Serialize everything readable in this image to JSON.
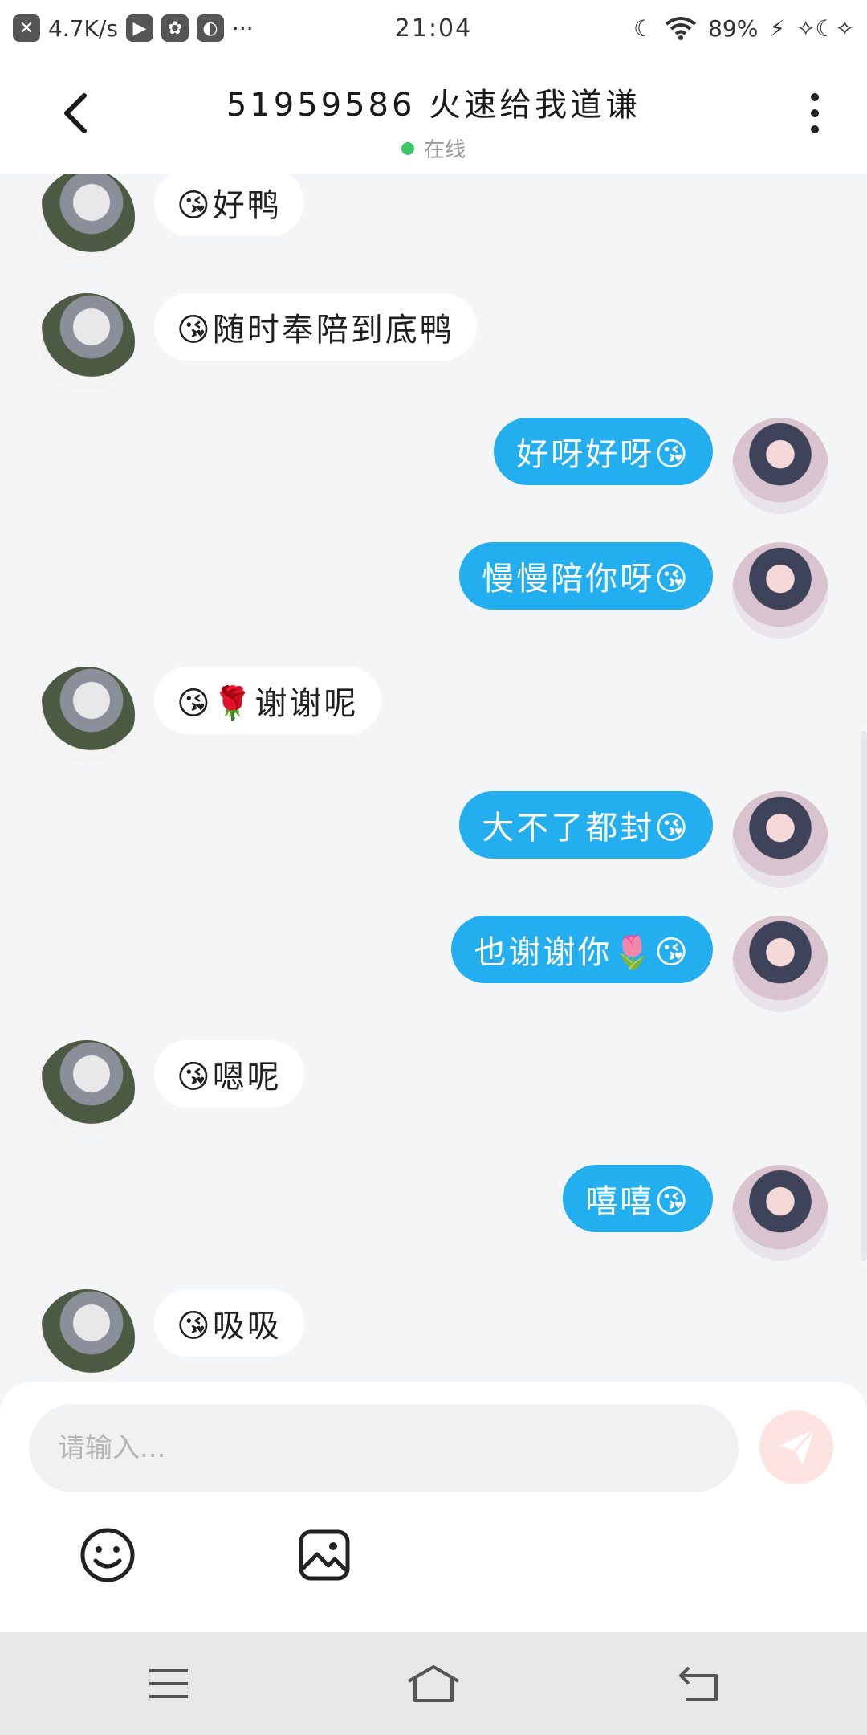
{
  "status_bar": {
    "net_speed": "4.7K/s",
    "time": "21:04",
    "battery": "89%",
    "more": "···"
  },
  "header": {
    "title": "51959586 火速给我道谦",
    "status": "在线"
  },
  "messages": [
    {
      "side": "in",
      "text": "😘好鸭"
    },
    {
      "side": "in",
      "text": "😘随时奉陪到底鸭"
    },
    {
      "side": "out",
      "text": "好呀好呀😘"
    },
    {
      "side": "out",
      "text": "慢慢陪你呀😘"
    },
    {
      "side": "in",
      "text": "😘🌹谢谢呢"
    },
    {
      "side": "out",
      "text": "大不了都封😘"
    },
    {
      "side": "out",
      "text": "也谢谢你🌷😘"
    },
    {
      "side": "in",
      "text": "😘嗯呢"
    },
    {
      "side": "out",
      "text": "嘻嘻😘"
    },
    {
      "side": "in",
      "text": "😘吸吸"
    }
  ],
  "input": {
    "placeholder": "请输入...",
    "value": ""
  },
  "toolbar": {
    "emoji_icon": "smile-icon",
    "image_icon": "image-icon",
    "send_icon": "paper-plane-icon"
  },
  "colors": {
    "bubble_out": "#23aef0",
    "bubble_in": "#ffffff",
    "online_dot": "#3ac569",
    "send_button": "#fde3e1",
    "background": "#f4f5f7"
  }
}
